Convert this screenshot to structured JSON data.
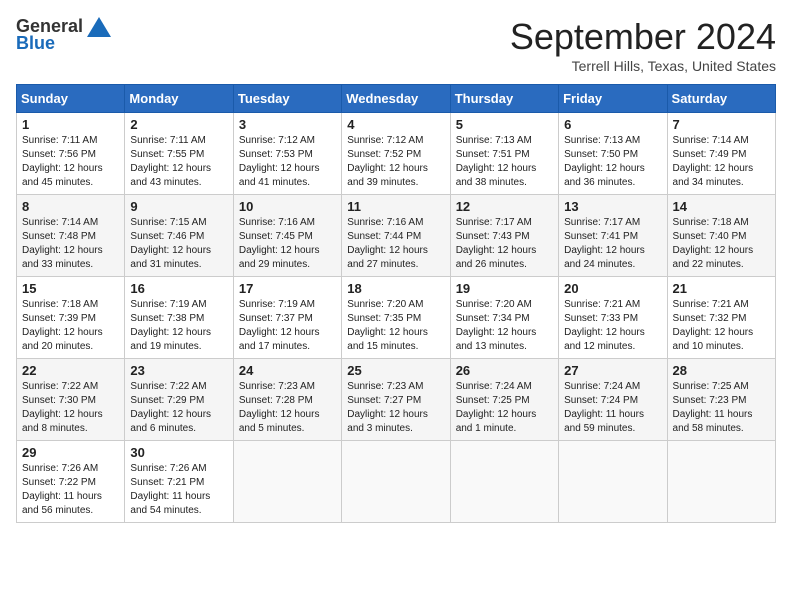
{
  "header": {
    "logo_general": "General",
    "logo_blue": "Blue",
    "month": "September 2024",
    "location": "Terrell Hills, Texas, United States"
  },
  "weekdays": [
    "Sunday",
    "Monday",
    "Tuesday",
    "Wednesday",
    "Thursday",
    "Friday",
    "Saturday"
  ],
  "weeks": [
    [
      {
        "day": "1",
        "info": "Sunrise: 7:11 AM\nSunset: 7:56 PM\nDaylight: 12 hours\nand 45 minutes."
      },
      {
        "day": "2",
        "info": "Sunrise: 7:11 AM\nSunset: 7:55 PM\nDaylight: 12 hours\nand 43 minutes."
      },
      {
        "day": "3",
        "info": "Sunrise: 7:12 AM\nSunset: 7:53 PM\nDaylight: 12 hours\nand 41 minutes."
      },
      {
        "day": "4",
        "info": "Sunrise: 7:12 AM\nSunset: 7:52 PM\nDaylight: 12 hours\nand 39 minutes."
      },
      {
        "day": "5",
        "info": "Sunrise: 7:13 AM\nSunset: 7:51 PM\nDaylight: 12 hours\nand 38 minutes."
      },
      {
        "day": "6",
        "info": "Sunrise: 7:13 AM\nSunset: 7:50 PM\nDaylight: 12 hours\nand 36 minutes."
      },
      {
        "day": "7",
        "info": "Sunrise: 7:14 AM\nSunset: 7:49 PM\nDaylight: 12 hours\nand 34 minutes."
      }
    ],
    [
      {
        "day": "8",
        "info": "Sunrise: 7:14 AM\nSunset: 7:48 PM\nDaylight: 12 hours\nand 33 minutes."
      },
      {
        "day": "9",
        "info": "Sunrise: 7:15 AM\nSunset: 7:46 PM\nDaylight: 12 hours\nand 31 minutes."
      },
      {
        "day": "10",
        "info": "Sunrise: 7:16 AM\nSunset: 7:45 PM\nDaylight: 12 hours\nand 29 minutes."
      },
      {
        "day": "11",
        "info": "Sunrise: 7:16 AM\nSunset: 7:44 PM\nDaylight: 12 hours\nand 27 minutes."
      },
      {
        "day": "12",
        "info": "Sunrise: 7:17 AM\nSunset: 7:43 PM\nDaylight: 12 hours\nand 26 minutes."
      },
      {
        "day": "13",
        "info": "Sunrise: 7:17 AM\nSunset: 7:41 PM\nDaylight: 12 hours\nand 24 minutes."
      },
      {
        "day": "14",
        "info": "Sunrise: 7:18 AM\nSunset: 7:40 PM\nDaylight: 12 hours\nand 22 minutes."
      }
    ],
    [
      {
        "day": "15",
        "info": "Sunrise: 7:18 AM\nSunset: 7:39 PM\nDaylight: 12 hours\nand 20 minutes."
      },
      {
        "day": "16",
        "info": "Sunrise: 7:19 AM\nSunset: 7:38 PM\nDaylight: 12 hours\nand 19 minutes."
      },
      {
        "day": "17",
        "info": "Sunrise: 7:19 AM\nSunset: 7:37 PM\nDaylight: 12 hours\nand 17 minutes."
      },
      {
        "day": "18",
        "info": "Sunrise: 7:20 AM\nSunset: 7:35 PM\nDaylight: 12 hours\nand 15 minutes."
      },
      {
        "day": "19",
        "info": "Sunrise: 7:20 AM\nSunset: 7:34 PM\nDaylight: 12 hours\nand 13 minutes."
      },
      {
        "day": "20",
        "info": "Sunrise: 7:21 AM\nSunset: 7:33 PM\nDaylight: 12 hours\nand 12 minutes."
      },
      {
        "day": "21",
        "info": "Sunrise: 7:21 AM\nSunset: 7:32 PM\nDaylight: 12 hours\nand 10 minutes."
      }
    ],
    [
      {
        "day": "22",
        "info": "Sunrise: 7:22 AM\nSunset: 7:30 PM\nDaylight: 12 hours\nand 8 minutes."
      },
      {
        "day": "23",
        "info": "Sunrise: 7:22 AM\nSunset: 7:29 PM\nDaylight: 12 hours\nand 6 minutes."
      },
      {
        "day": "24",
        "info": "Sunrise: 7:23 AM\nSunset: 7:28 PM\nDaylight: 12 hours\nand 5 minutes."
      },
      {
        "day": "25",
        "info": "Sunrise: 7:23 AM\nSunset: 7:27 PM\nDaylight: 12 hours\nand 3 minutes."
      },
      {
        "day": "26",
        "info": "Sunrise: 7:24 AM\nSunset: 7:25 PM\nDaylight: 12 hours\nand 1 minute."
      },
      {
        "day": "27",
        "info": "Sunrise: 7:24 AM\nSunset: 7:24 PM\nDaylight: 11 hours\nand 59 minutes."
      },
      {
        "day": "28",
        "info": "Sunrise: 7:25 AM\nSunset: 7:23 PM\nDaylight: 11 hours\nand 58 minutes."
      }
    ],
    [
      {
        "day": "29",
        "info": "Sunrise: 7:26 AM\nSunset: 7:22 PM\nDaylight: 11 hours\nand 56 minutes."
      },
      {
        "day": "30",
        "info": "Sunrise: 7:26 AM\nSunset: 7:21 PM\nDaylight: 11 hours\nand 54 minutes."
      },
      {
        "day": "",
        "info": ""
      },
      {
        "day": "",
        "info": ""
      },
      {
        "day": "",
        "info": ""
      },
      {
        "day": "",
        "info": ""
      },
      {
        "day": "",
        "info": ""
      }
    ]
  ]
}
